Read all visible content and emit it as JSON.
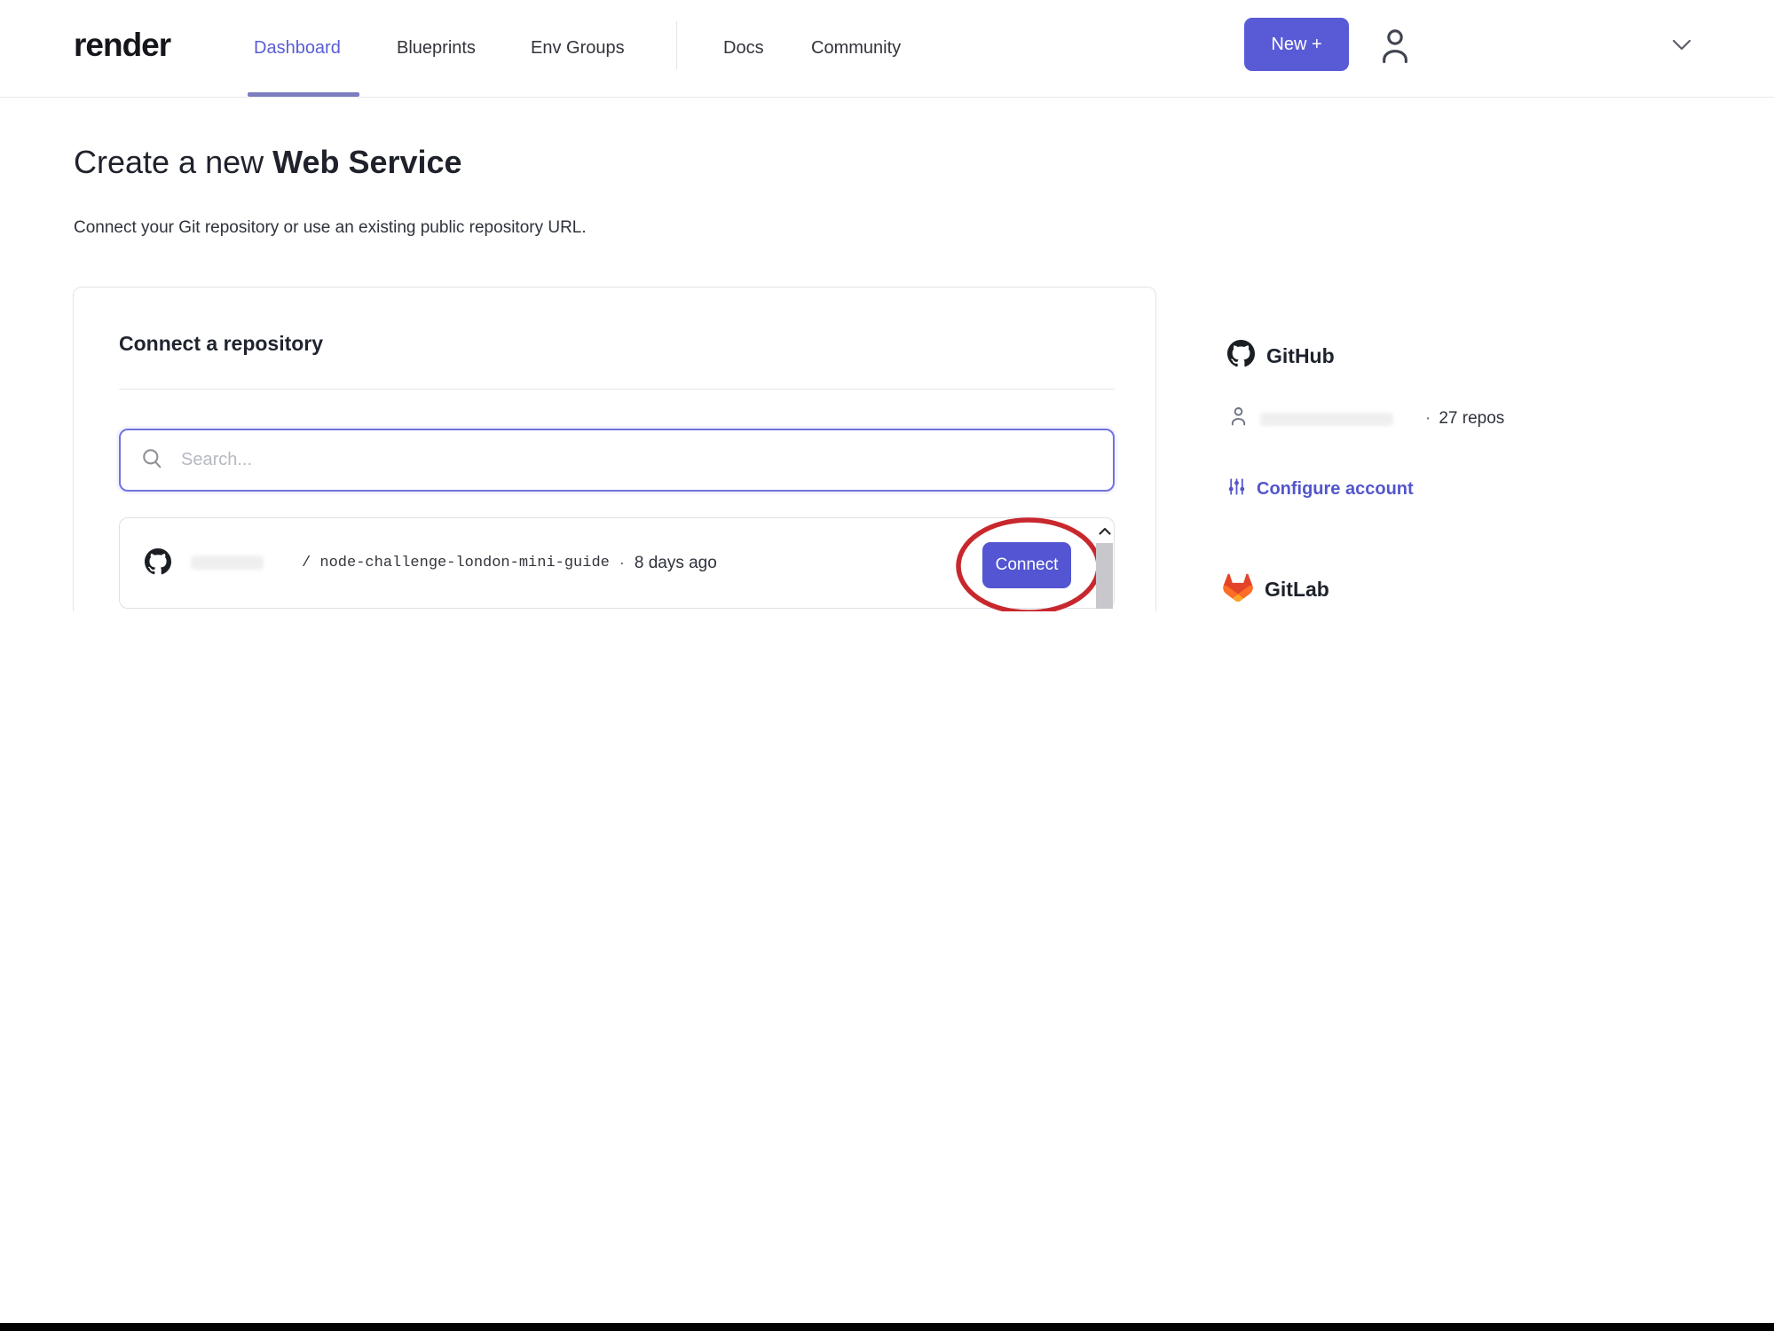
{
  "header": {
    "logo": "render",
    "nav": [
      {
        "label": "Dashboard",
        "active": true
      },
      {
        "label": "Blueprints",
        "active": false
      },
      {
        "label": "Env Groups",
        "active": false
      },
      {
        "label": "Docs",
        "active": false
      },
      {
        "label": "Community",
        "active": false
      }
    ],
    "new_button_label": "New +"
  },
  "page": {
    "title_prefix": "Create a new ",
    "title_emphasis": "Web Service",
    "subtitle": "Connect your Git repository or use an existing public repository URL."
  },
  "card": {
    "heading": "Connect a repository",
    "search": {
      "placeholder": "Search..."
    },
    "repo_row": {
      "path": "/ node-challenge-london-mini-guide",
      "separator": "·",
      "updated": "8 days ago",
      "connect_label": "Connect"
    }
  },
  "sidebar": {
    "github": {
      "label": "GitHub",
      "repos_separator": "·",
      "repos_count": "27 repos",
      "configure_label": "Configure account"
    },
    "gitlab": {
      "label": "GitLab"
    }
  },
  "colors": {
    "accent_indigo": "#585ad6",
    "active_nav_indigo": "#5a5dd4",
    "annotation_red": "#c8282d",
    "gitlab_orange": "#e24329",
    "github_black": "#1b1f23"
  }
}
